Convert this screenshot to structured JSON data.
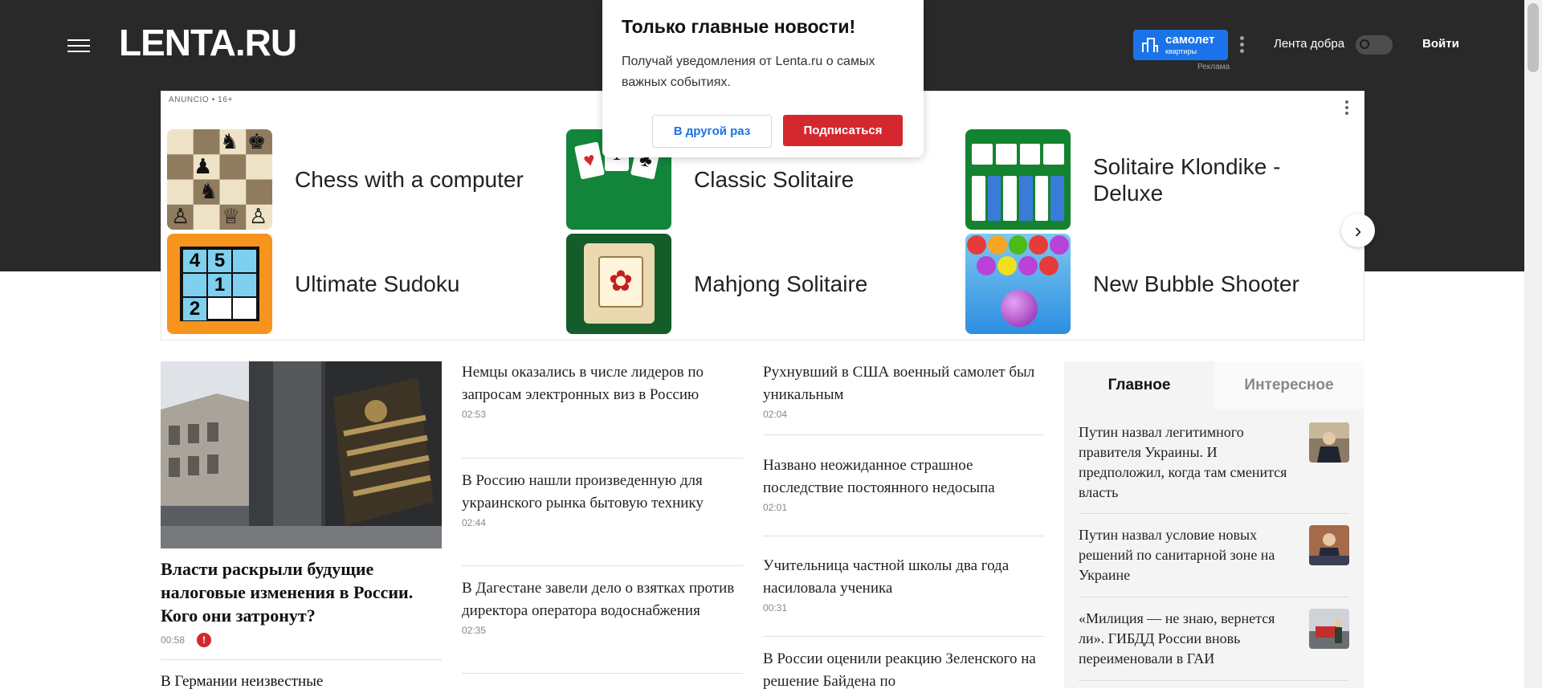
{
  "header": {
    "logo": "LENTA.RU",
    "promo": {
      "title": "самолет",
      "subtitle": "квартиры",
      "ad_label": "Реклама"
    },
    "good_news_label": "Лента добра",
    "login_label": "Войти"
  },
  "popup": {
    "title": "Только главные новости!",
    "text": "Получай уведомления от Lenta.ru о самых важных событиях.",
    "later_label": "В другой раз",
    "subscribe_label": "Подписаться"
  },
  "ad": {
    "label": "ANUNCIO • 16+",
    "games": [
      {
        "name": "Chess with a computer",
        "icon": "chess-icon"
      },
      {
        "name": "Classic Solitaire",
        "icon": "solitaire-icon"
      },
      {
        "name": "Solitaire Klondike - Deluxe",
        "icon": "klondike-icon"
      },
      {
        "name": "Ultimate Sudoku",
        "icon": "sudoku-icon"
      },
      {
        "name": "Mahjong Solitaire",
        "icon": "mahjong-icon"
      },
      {
        "name": "New Bubble Shooter",
        "icon": "bubble-shooter-icon"
      }
    ]
  },
  "main_story": {
    "title": "Власти раскрыли будущие налоговые изменения в России. Кого они затронут?",
    "time": "00:58",
    "alert": "!",
    "next_title": "В Германии неизвестные"
  },
  "column1": [
    {
      "title": "Немцы оказались в числе лидеров по запросам электронных виз в Россию",
      "time": "02:53"
    },
    {
      "title": "В Россию нашли произведенную для украинского рынка бытовую технику",
      "time": "02:44"
    },
    {
      "title": "В Дагестане завели дело о взятках против директора оператора водоснабжения",
      "time": "02:35"
    }
  ],
  "column2": [
    {
      "title": "Рухнувший в США военный самолет был уникальным",
      "time": "02:04"
    },
    {
      "title": "Названо неожиданное страшное последствие постоянного недосыпа",
      "time": "02:01"
    },
    {
      "title": "Учительница частной школы два года насиловала ученика",
      "time": "00:31"
    },
    {
      "title": "В России оценили реакцию Зеленского на решение Байдена по",
      "time": ""
    }
  ],
  "sidebar": {
    "tabs": [
      "Главное",
      "Интересное"
    ],
    "items": [
      {
        "title": "Путин назвал легитимного правителя Украины. И предположил, когда там сменится власть"
      },
      {
        "title": "Путин назвал условие новых решений по санитарной зоне на Украине"
      },
      {
        "title": "«Милиция — не знаю, вернется ли». ГИБДД России вновь переименовали в ГАИ"
      }
    ]
  },
  "colors": {
    "header_bg": "#292929",
    "accent_red": "#d4282f",
    "promo_blue": "#1a73e8"
  }
}
